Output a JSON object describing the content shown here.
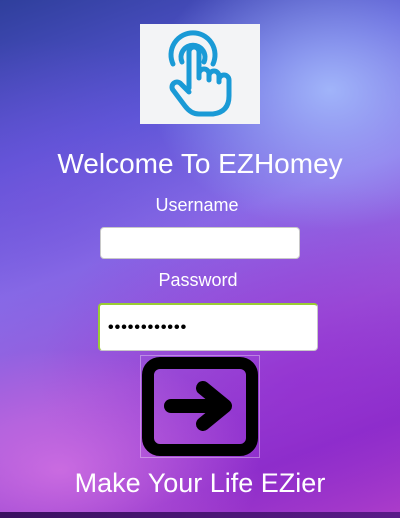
{
  "app": {
    "title": "Welcome To EZHomey",
    "tagline": "Make Your Life EZier"
  },
  "logo": {
    "icon": "hand-tap-icon",
    "color": "#1a9ad6"
  },
  "login_form": {
    "username_label": "Username",
    "username_value": "",
    "password_label": "Password",
    "password_value": "••••••••••••",
    "submit_icon": "arrow-right-icon"
  },
  "colors": {
    "accent_focus_border": "#9acd32",
    "text": "#ffffff"
  }
}
